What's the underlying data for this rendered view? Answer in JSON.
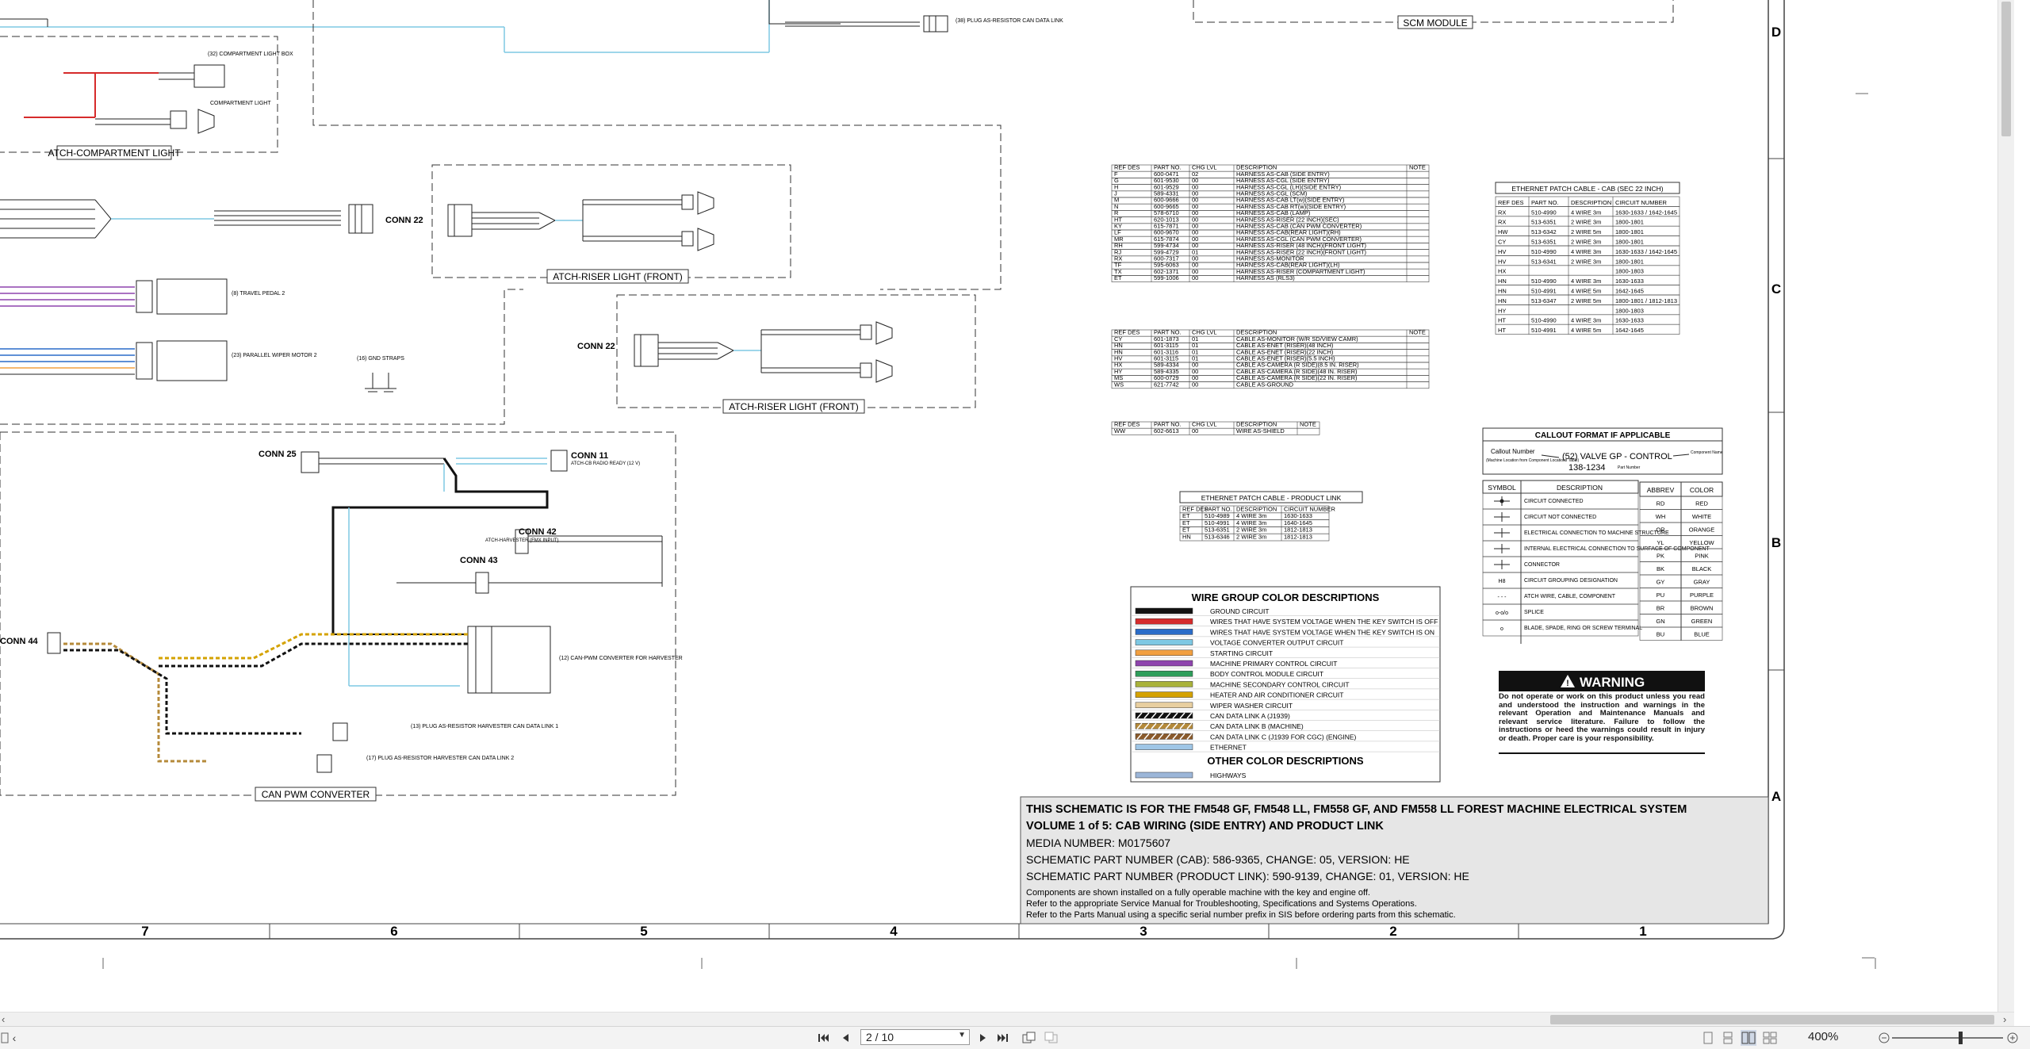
{
  "schematic": {
    "module_labels": {
      "scm_module": "SCM MODULE",
      "atch_compartment_light": "ATCH-COMPARTMENT LIGHT",
      "atch_riser_light_front_1": "ATCH-RISER LIGHT (FRONT)",
      "atch_riser_light_front_2": "ATCH-RISER LIGHT (FRONT)",
      "can_pwm_converter": "CAN PWM CONVERTER"
    },
    "connectors": [
      "CONN 22",
      "CONN 22",
      "CONN 25",
      "CONN 11",
      "CONN 42",
      "CONN 43",
      "CONN 44"
    ],
    "row_letters": [
      "D",
      "C",
      "B",
      "A"
    ],
    "column_numbers": [
      "7",
      "6",
      "5",
      "4",
      "3",
      "2",
      "1"
    ],
    "harness_table": {
      "headers": [
        "REF DES",
        "PART NO.",
        "CHG LVL",
        "DESCRIPTION",
        "NOTE"
      ],
      "rows": [
        [
          "F",
          "600-0471",
          "02",
          "HARNESS AS-CAB (SIDE ENTRY)",
          ""
        ],
        [
          "G",
          "601-9530",
          "00",
          "HARNESS AS-CGL (SIDE ENTRY)",
          ""
        ],
        [
          "H",
          "601-9529",
          "00",
          "HARNESS AS-CGL (LH)(SIDE ENTRY)",
          ""
        ],
        [
          "J",
          "589-4331",
          "00",
          "HARNESS AS-CGL (SCM)",
          ""
        ],
        [
          "M",
          "600-9666",
          "00",
          "HARNESS AS-CAB LT(w)(SIDE ENTRY)",
          ""
        ],
        [
          "N",
          "600-9665",
          "00",
          "HARNESS AS-CAB RT(w)(SIDE ENTRY)",
          ""
        ],
        [
          "R",
          "578-6710",
          "00",
          "HARNESS AS-CAB (LAMP)",
          ""
        ],
        [
          "HT",
          "620-1013",
          "00",
          "HARNESS AS-RISER (22 INCH)(SEC)",
          ""
        ],
        [
          "KY",
          "615-7871",
          "00",
          "HARNESS AS-CAB (CAN PWM CONVERTER)",
          ""
        ],
        [
          "LF",
          "600-9670",
          "00",
          "HARNESS AS-CAB(REAR LIGHT)(RH)",
          ""
        ],
        [
          "MR",
          "615-7874",
          "00",
          "HARNESS AS-CGL (CAN PWM CONVERTER)",
          ""
        ],
        [
          "RH",
          "599-4734",
          "00",
          "HARNESS AS-RISER (48 INCH)(FRONT LIGHT)",
          ""
        ],
        [
          "RJ",
          "599-4729",
          "01",
          "HARNESS AS-RISER (22 INCH)(FRONT LIGHT)",
          ""
        ],
        [
          "RX",
          "600-7317",
          "00",
          "HARNESS AS-MONITOR",
          ""
        ],
        [
          "TF",
          "595-6063",
          "00",
          "HARNESS AS-CAB(REAR LIGHT)(LH)",
          ""
        ],
        [
          "TX",
          "602-1371",
          "00",
          "HARNESS AS-RISER (COMPARTMENT LIGHT)",
          ""
        ],
        [
          "ET",
          "599-1006",
          "00",
          "HARNESS AS (RLS3)",
          ""
        ]
      ]
    },
    "cable_table": {
      "headers": [
        "REF DES",
        "PART NO.",
        "CHG LVL",
        "DESCRIPTION",
        "NOTE"
      ],
      "rows": [
        [
          "CY",
          "601-1873",
          "01",
          "CABLE AS-MONITOR (W/R SD/VIEW CAMR)",
          ""
        ],
        [
          "HN",
          "601-3115",
          "01",
          "CABLE AS-ENET (RISER)(48 INCH)",
          ""
        ],
        [
          "HN",
          "601-3116",
          "01",
          "CABLE AS-ENET (RISER)(22 INCH)",
          ""
        ],
        [
          "HV",
          "601-3115",
          "01",
          "CABLE AS-ENET (RISER)(5.5 INCH)",
          ""
        ],
        [
          "HX",
          "589-4334",
          "00",
          "CABLE AS-CAMERA (R SIDE)(8.5 IN. RISER)",
          ""
        ],
        [
          "HY",
          "589-4335",
          "00",
          "CABLE AS-CAMERA (R SIDE)(48 IN. RISER)",
          ""
        ],
        [
          "MS",
          "600-0729",
          "00",
          "CABLE AS-CAMERA (R SIDE)(22 IN. RISER)",
          ""
        ],
        [
          "WS",
          "621-7742",
          "00",
          "CABLE AS-GROUND",
          ""
        ]
      ]
    },
    "wire_table": {
      "headers": [
        "REF DES",
        "PART NO.",
        "CHG LVL",
        "DESCRIPTION",
        "NOTE"
      ],
      "rows": [
        [
          "WW",
          "602-6613",
          "00",
          "WIRE AS-SHIELD",
          ""
        ]
      ]
    },
    "ethernet_product_link": {
      "title": "ETHERNET PATCH CABLE - PRODUCT LINK",
      "headers": [
        "REF DES",
        "PART NO.",
        "DESCRIPTION",
        "CIRCUIT NUMBER"
      ],
      "rows": [
        [
          "ET",
          "510-4989",
          "4 WIRE 3m",
          "1630-1633"
        ],
        [
          "ET",
          "510-4991",
          "4 WIRE 3m",
          "1640-1645"
        ],
        [
          "ET",
          "513-6351",
          "2 WIRE 3m",
          "1812-1813"
        ],
        [
          "HN",
          "513-6346",
          "2 WIRE 3m",
          "1812-1813"
        ]
      ]
    },
    "ethernet_cab": {
      "title": "ETHERNET PATCH CABLE - CAB (SEC 22 INCH)",
      "headers": [
        "REF DES",
        "PART NO.",
        "DESCRIPTION",
        "CIRCUIT NUMBER"
      ],
      "rows": [
        [
          "RX",
          "510-4990",
          "4 WIRE 3m",
          "1630-1633 / 1642-1645"
        ],
        [
          "RX",
          "513-6351",
          "2 WIRE 3m",
          "1800-1801"
        ],
        [
          "HW",
          "513-6342",
          "2 WIRE 5m",
          "1800-1801"
        ],
        [
          "CY",
          "513-6351",
          "2 WIRE 3m",
          "1800-1801"
        ],
        [
          "HV",
          "510-4990",
          "4 WIRE 3m",
          "1630-1633 / 1642-1645"
        ],
        [
          "HV",
          "513-6341",
          "2 WIRE 3m",
          "1800-1801"
        ],
        [
          "HX",
          "",
          "",
          "1800-1803"
        ],
        [
          "HN",
          "510-4990",
          "4 WIRE 3m",
          "1630-1633"
        ],
        [
          "HN",
          "510-4991",
          "4 WIRE 5m",
          "1642-1645"
        ],
        [
          "HN",
          "513-6347",
          "2 WIRE 5m",
          "1800-1801 / 1812-1813"
        ],
        [
          "HY",
          "",
          "",
          "1800-1803"
        ],
        [
          "HT",
          "510-4990",
          "4 WIRE 3m",
          "1630-1633"
        ],
        [
          "HT",
          "510-4991",
          "4 WIRE 5m",
          "1642-1645"
        ]
      ]
    },
    "callout": {
      "title": "CALLOUT FORMAT IF APPLICABLE",
      "callout_number": "Callout Number",
      "machine_location": "(Machine Location from Component Locations Table)",
      "example": "(52) VALVE GP - CONTROL",
      "part_number": "138-1234",
      "component_name": "Component Name",
      "part_number_label": "Part Number"
    },
    "symbols": {
      "headers": [
        "SYMBOL",
        "DESCRIPTION"
      ],
      "rows": [
        "CIRCUIT CONNECTED",
        "CIRCUIT NOT CONNECTED",
        "ELECTRICAL CONNECTION TO MACHINE STRUCTURE",
        "INTERNAL ELECTRICAL CONNECTION TO SURFACE OF COMPONENT",
        "CONNECTOR",
        "CIRCUIT GROUPING DESIGNATION",
        "ATCH WIRE, CABLE, COMPONENT",
        "SPLICE",
        "BLADE, SPADE, RING OR SCREW TERMINAL"
      ],
      "symbol_marks": [
        "",
        "",
        "",
        "",
        "",
        "H8",
        "- - -",
        "o-o/o",
        "o"
      ]
    },
    "abbrev": {
      "headers": [
        "ABBREV",
        "COLOR"
      ],
      "rows": [
        [
          "RD",
          "RED"
        ],
        [
          "WH",
          "WHITE"
        ],
        [
          "OR",
          "ORANGE"
        ],
        [
          "YL",
          "YELLOW"
        ],
        [
          "PK",
          "PINK"
        ],
        [
          "BK",
          "BLACK"
        ],
        [
          "GY",
          "GRAY"
        ],
        [
          "PU",
          "PURPLE"
        ],
        [
          "BR",
          "BROWN"
        ],
        [
          "GN",
          "GREEN"
        ],
        [
          "BU",
          "BLUE"
        ]
      ]
    },
    "wire_colors": {
      "title": "WIRE GROUP COLOR DESCRIPTIONS",
      "rows": [
        {
          "color": "#111111",
          "label": "GROUND CIRCUIT"
        },
        {
          "color": "#d62b2b",
          "label": "WIRES THAT HAVE SYSTEM VOLTAGE WHEN THE KEY SWITCH IS OFF"
        },
        {
          "color": "#2a6cc8",
          "label": "WIRES THAT HAVE SYSTEM VOLTAGE WHEN THE KEY SWITCH IS ON"
        },
        {
          "color": "#7ec8e3",
          "label": "VOLTAGE CONVERTER OUTPUT CIRCUIT"
        },
        {
          "color": "#f2a040",
          "label": "STARTING CIRCUIT"
        },
        {
          "color": "#8e44ad",
          "label": "MACHINE PRIMARY CONTROL CIRCUIT"
        },
        {
          "color": "#2e9e5a",
          "label": "BODY CONTROL MODULE CIRCUIT"
        },
        {
          "color": "#a9b23a",
          "label": "MACHINE SECONDARY CONTROL CIRCUIT"
        },
        {
          "color": "#d4a200",
          "label": "HEATER AND AIR CONDITIONER CIRCUIT"
        },
        {
          "color": "#e8cfa0",
          "label": "WIPER WASHER CIRCUIT"
        },
        {
          "color": "#111111",
          "label": "CAN DATA LINK A (J1939)"
        },
        {
          "color": "#b58a3a",
          "label": "CAN DATA LINK B (MACHINE)"
        },
        {
          "color": "#8a5a2b",
          "label": "CAN DATA LINK C (J1939 FOR CGC) (ENGINE)"
        },
        {
          "color": "#9fc6e6",
          "label": "ETHERNET"
        }
      ],
      "other_title": "OTHER COLOR DESCRIPTIONS",
      "other_rows": [
        {
          "color": "#9cb6d8",
          "label": "HIGHWAYS"
        }
      ]
    },
    "warning": {
      "title": "WARNING",
      "text": "Do not operate or work on this product unless you read and understood the instruction and warnings in the relevant Operation and Maintenance Manuals and relevant service literature. Failure to follow the instructions or heed the warnings could result in injury or death. Proper care is your responsibility."
    },
    "title_block": {
      "line1": "THIS SCHEMATIC IS FOR THE FM548 GF, FM548 LL, FM558 GF, AND FM558 LL FOREST MACHINE ELECTRICAL SYSTEM",
      "line2": "VOLUME 1 of 5: CAB WIRING (SIDE ENTRY) AND PRODUCT LINK",
      "media": "MEDIA NUMBER: M0175607",
      "cab": "SCHEMATIC PART NUMBER (CAB): 586-9365, CHANGE: 05, VERSION: HE",
      "product_link": "SCHEMATIC PART NUMBER (PRODUCT LINK): 590-9139, CHANGE: 01, VERSION: HE",
      "note1": "Components are shown installed on a fully operable machine with the key and engine off.",
      "note2": "Refer to the appropriate Service Manual for Troubleshooting, Specifications and Systems Operations.",
      "note3": "Refer to the Parts Manual using a specific serial number prefix in SIS before ordering parts from this schematic."
    },
    "small_labels": {
      "compartment_light_box": "(32) COMPARTMENT LIGHT BOX",
      "compartment_light": "COMPARTMENT LIGHT",
      "travel_pedal": "(8) TRAVEL PEDAL 2",
      "parallel_wiper": "(23) PARALLEL WIPER MOTOR 2",
      "gnd_straps": "(16) GND STRAPS",
      "conn11_desc": "ATCH-CB RADIO READY (12 V)",
      "harvester_desc": "ATCH-HARVESTER (FMX INPUT)",
      "can_pwm_desc": "(12) CAN-PWM CONVERTER FOR HARVESTER",
      "plug_resistor_1": "(13) PLUG AS-RESISTOR HARVESTER CAN DATA LINK 1",
      "plug_resistor_2": "(17) PLUG AS-RESISTOR HARVESTER CAN DATA LINK 2",
      "can_data_link_plug": "(38) PLUG AS-RESISTOR CAN DATA LINK"
    }
  },
  "viewer": {
    "page_value": "2 / 10",
    "zoom": "400%"
  }
}
